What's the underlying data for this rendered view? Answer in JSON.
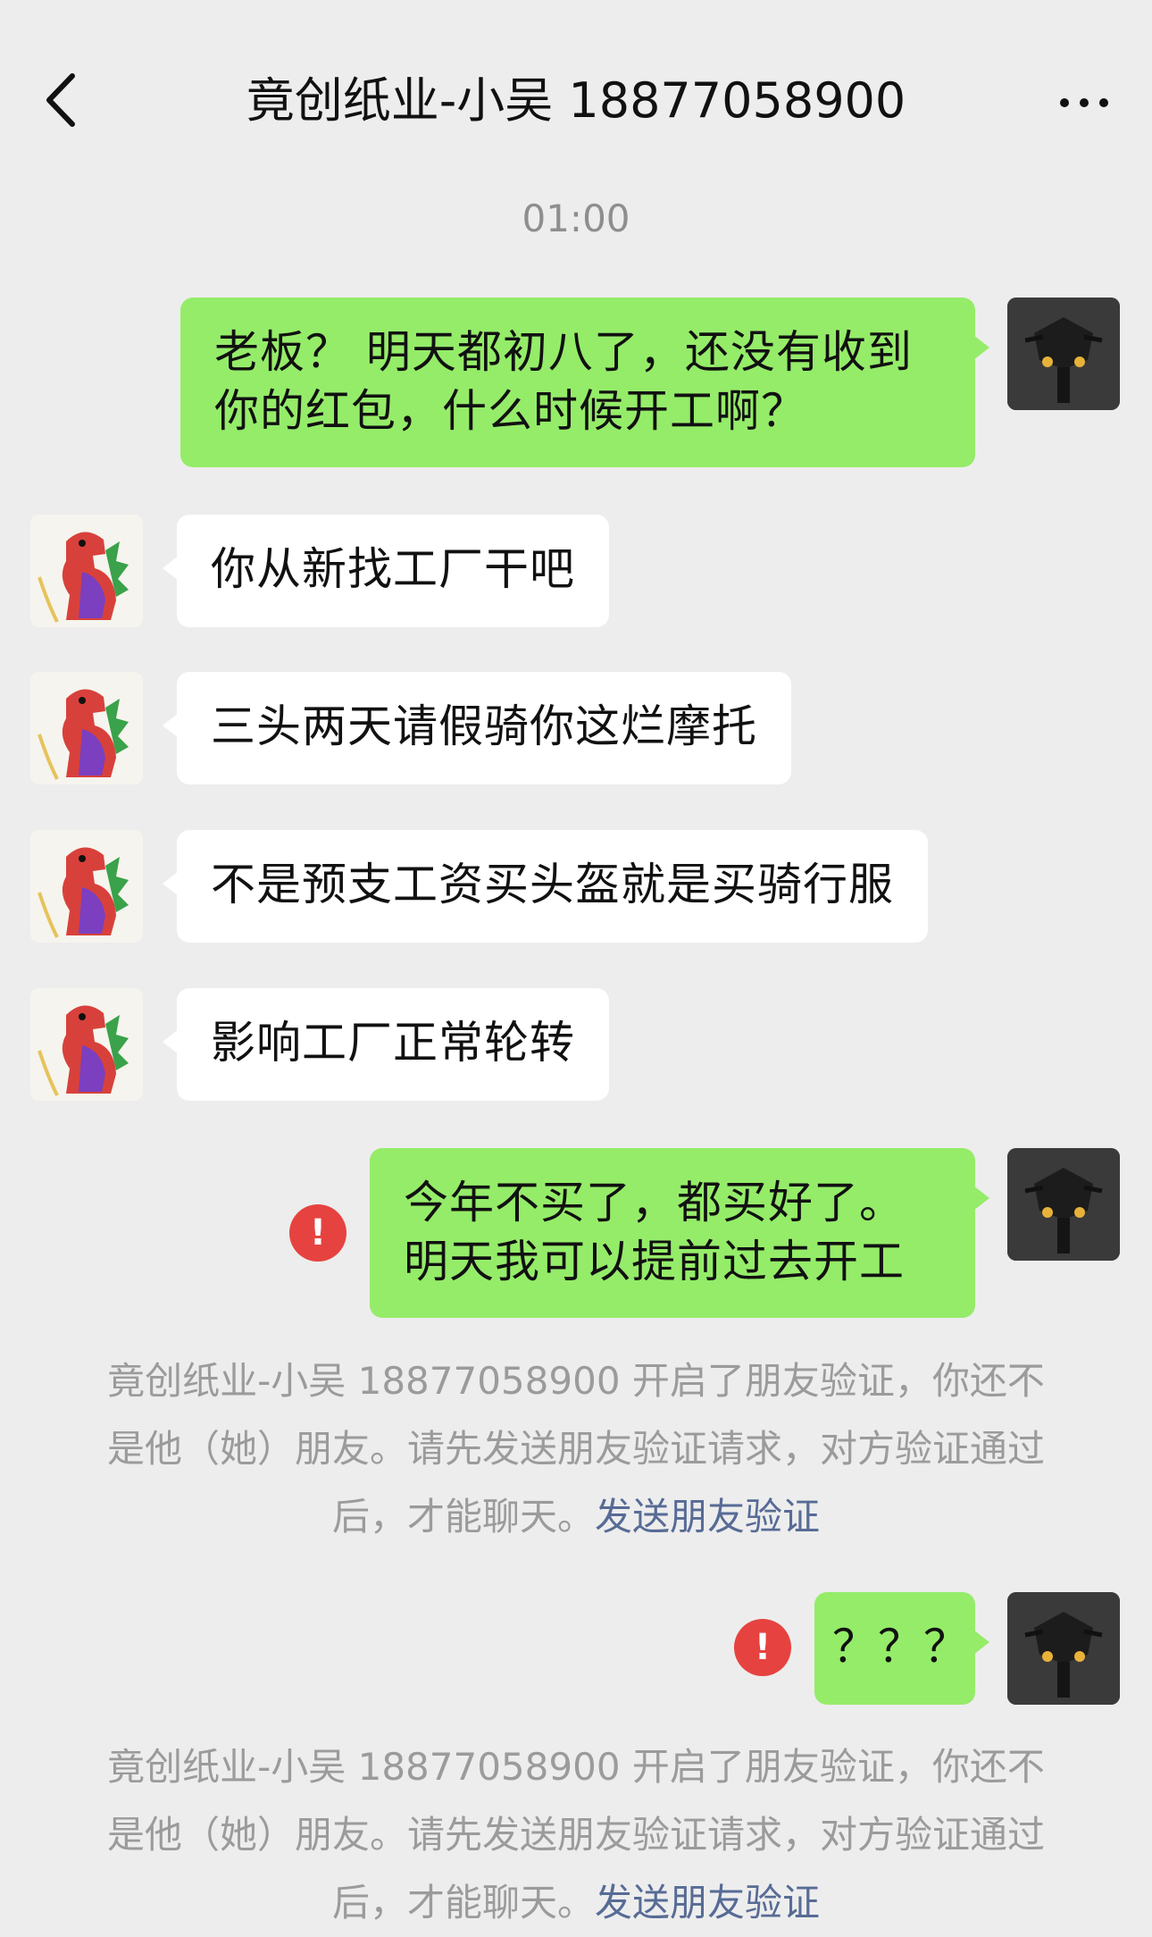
{
  "header": {
    "title": "竟创纸业-小吴 18877058900",
    "back_icon": "chevron-left-icon",
    "more_icon": "more-dots-icon"
  },
  "timestamp": "01:00",
  "messages": [
    {
      "from": "me",
      "text": "老板？ 明天都初八了，还没有收到\n你的红包，什么时候开工啊？",
      "failed": false
    },
    {
      "from": "other",
      "text": "你从新找工厂干吧"
    },
    {
      "from": "other",
      "text": "三头两天请假骑你这烂摩托"
    },
    {
      "from": "other",
      "text": "不是预支工资买头盔就是买骑行服"
    },
    {
      "from": "other",
      "text": "影响工厂正常轮转"
    },
    {
      "from": "me",
      "text": "今年不买了，都买好了。\n明天我可以提前过去开工",
      "failed": true
    },
    {
      "from": "me",
      "text": "？？？",
      "failed": true
    }
  ],
  "failed_mark": "!",
  "system_notice": {
    "line1": "竟创纸业-小吴 18877058900 开启了朋友验证，你还不",
    "line2": "是他（她）朋友。请先发送朋友验证请求，对方验证通过",
    "line3_prefix": "后，才能聊天。",
    "link": "发送朋友验证"
  },
  "colors": {
    "background": "#ededed",
    "my_bubble": "#95ec69",
    "other_bubble": "#ffffff",
    "fail_icon": "#e64340",
    "link": "#576b95",
    "system_text": "#9b9b9b"
  }
}
